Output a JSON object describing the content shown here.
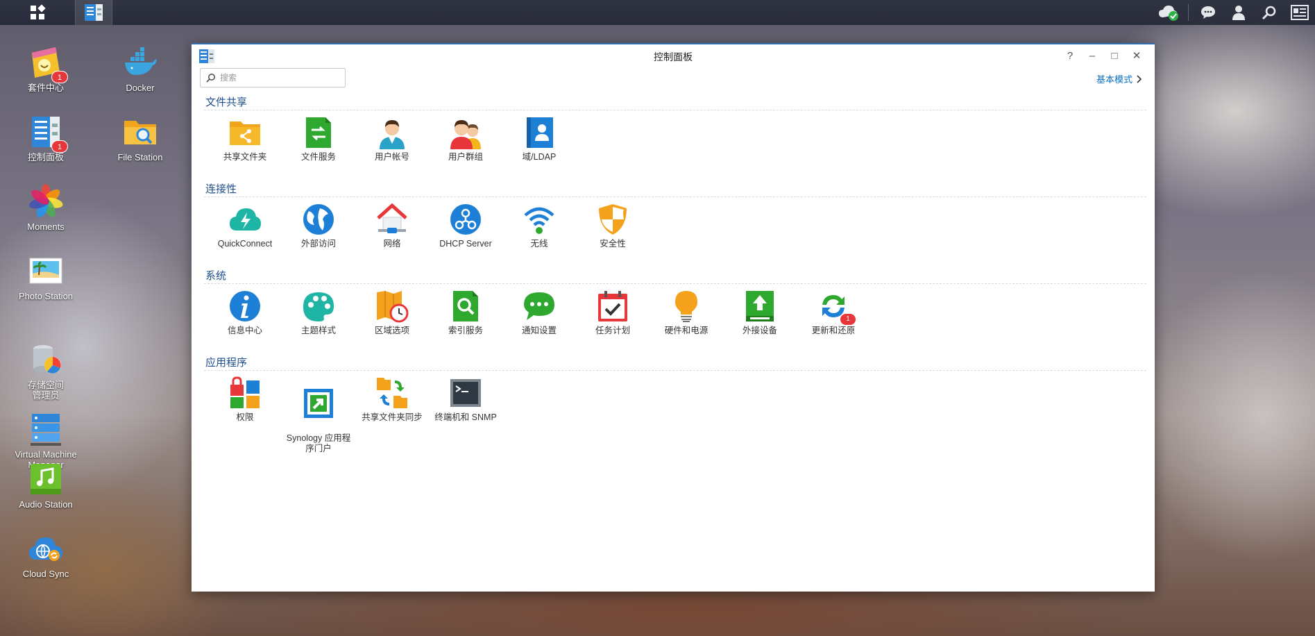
{
  "taskbar": {
    "main_menu_icon": "grid-icon",
    "open_app_icon": "control-panel-icon",
    "right_icons": [
      "cloud-check-icon",
      "chat-icon",
      "user-icon",
      "search-icon",
      "widgets-icon"
    ]
  },
  "desktop": {
    "icons": [
      {
        "label": "套件中心",
        "icon": "package-center-icon",
        "badge": "1"
      },
      {
        "label": "Docker",
        "icon": "docker-icon",
        "badge": ""
      },
      {
        "label": "控制面板",
        "icon": "control-panel-icon",
        "badge": "1"
      },
      {
        "label": "File Station",
        "icon": "folder-search-icon",
        "badge": ""
      },
      {
        "label": "Moments",
        "icon": "moments-icon",
        "badge": ""
      },
      {
        "label": "Photo Station",
        "icon": "photo-icon",
        "badge": ""
      },
      {
        "label": "存储空间\n管理员",
        "icon": "storage-manager-icon",
        "badge": ""
      },
      {
        "label": "Virtual Machine\nManager",
        "icon": "vm-manager-icon",
        "badge": ""
      },
      {
        "label": "Audio Station",
        "icon": "audio-icon",
        "badge": ""
      },
      {
        "label": "Cloud Sync",
        "icon": "cloud-sync-icon",
        "badge": ""
      }
    ]
  },
  "window": {
    "title": "控制面板",
    "search_placeholder": "搜索",
    "mode_link": "基本模式",
    "controls": {
      "help": "?",
      "minimize": "–",
      "maximize": "□",
      "close": "✕"
    }
  },
  "sections": [
    {
      "title": "文件共享",
      "items": [
        {
          "label": "共享文件夹",
          "icon": "shared-folder-icon",
          "badge": ""
        },
        {
          "label": "文件服务",
          "icon": "file-services-icon",
          "badge": ""
        },
        {
          "label": "用户帐号",
          "icon": "user-account-icon",
          "badge": ""
        },
        {
          "label": "用户群组",
          "icon": "user-group-icon",
          "badge": ""
        },
        {
          "label": "域/LDAP",
          "icon": "ldap-icon",
          "badge": ""
        }
      ]
    },
    {
      "title": "连接性",
      "items": [
        {
          "label": "QuickConnect",
          "icon": "quickconnect-icon",
          "badge": ""
        },
        {
          "label": "外部访问",
          "icon": "globe-icon",
          "badge": ""
        },
        {
          "label": "网络",
          "icon": "network-house-icon",
          "badge": ""
        },
        {
          "label": "DHCP Server",
          "icon": "dhcp-icon",
          "badge": ""
        },
        {
          "label": "无线",
          "icon": "wifi-icon",
          "badge": ""
        },
        {
          "label": "安全性",
          "icon": "shield-icon",
          "badge": ""
        }
      ]
    },
    {
      "title": "系统",
      "items": [
        {
          "label": "信息中心",
          "icon": "info-icon",
          "badge": ""
        },
        {
          "label": "主题样式",
          "icon": "palette-icon",
          "badge": ""
        },
        {
          "label": "区域选项",
          "icon": "regional-clock-icon",
          "badge": ""
        },
        {
          "label": "索引服务",
          "icon": "index-search-icon",
          "badge": ""
        },
        {
          "label": "通知设置",
          "icon": "notification-icon",
          "badge": ""
        },
        {
          "label": "任务计划",
          "icon": "calendar-check-icon",
          "badge": ""
        },
        {
          "label": "硬件和电源",
          "icon": "bulb-icon",
          "badge": ""
        },
        {
          "label": "外接设备",
          "icon": "external-device-icon",
          "badge": ""
        },
        {
          "label": "更新和还原",
          "icon": "update-restore-icon",
          "badge": "1"
        }
      ]
    },
    {
      "title": "应用程序",
      "items": [
        {
          "label": "权限",
          "icon": "privileges-icon",
          "badge": ""
        },
        {
          "label": "Synology 应用程\n序门户",
          "icon": "app-portal-icon",
          "badge": ""
        },
        {
          "label": "共享文件夹同步",
          "icon": "folder-sync-icon",
          "badge": ""
        },
        {
          "label": "终端机和 SNMP",
          "icon": "terminal-icon",
          "badge": ""
        }
      ]
    }
  ]
}
